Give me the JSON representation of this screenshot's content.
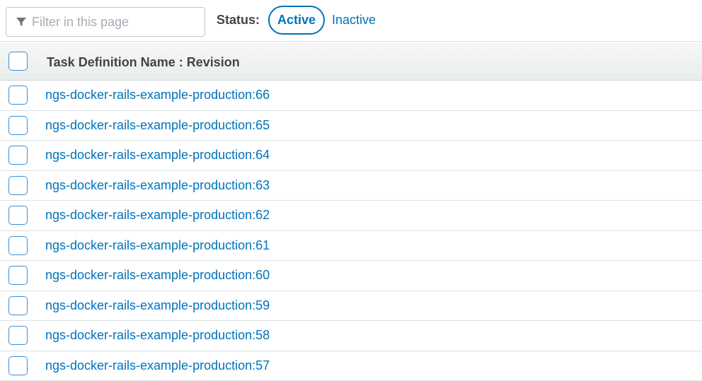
{
  "filter": {
    "placeholder": "Filter in this page",
    "icon": "filter-icon"
  },
  "status": {
    "label": "Status:",
    "active_label": "Active",
    "inactive_label": "Inactive",
    "selected": "Active"
  },
  "table": {
    "header": "Task Definition Name : Revision",
    "rows": [
      {
        "name": "ngs-docker-rails-example-production:66"
      },
      {
        "name": "ngs-docker-rails-example-production:65"
      },
      {
        "name": "ngs-docker-rails-example-production:64"
      },
      {
        "name": "ngs-docker-rails-example-production:63"
      },
      {
        "name": "ngs-docker-rails-example-production:62"
      },
      {
        "name": "ngs-docker-rails-example-production:61"
      },
      {
        "name": "ngs-docker-rails-example-production:60"
      },
      {
        "name": "ngs-docker-rails-example-production:59"
      },
      {
        "name": "ngs-docker-rails-example-production:58"
      },
      {
        "name": "ngs-docker-rails-example-production:57"
      }
    ]
  },
  "colors": {
    "link": "#0073bb",
    "checkbox_border": "#3b8fd6",
    "header_bg": "#eaeded"
  }
}
